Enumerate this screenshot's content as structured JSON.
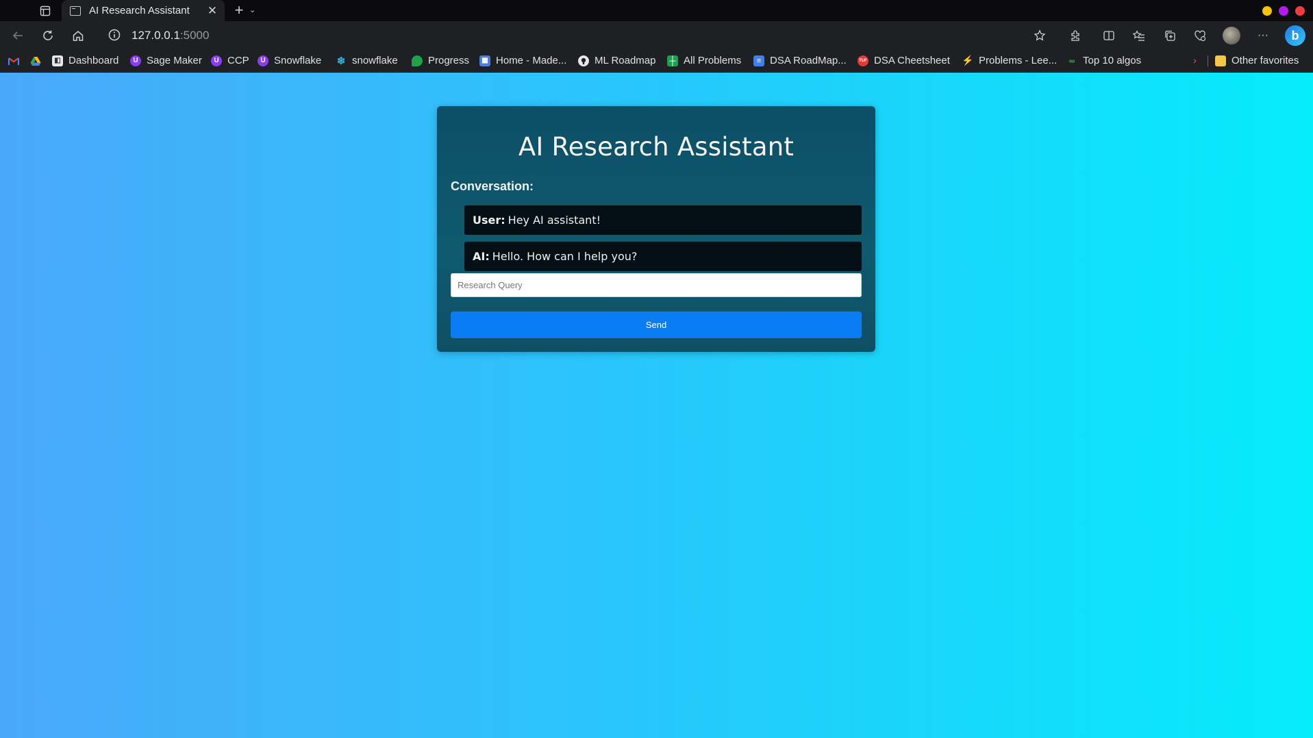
{
  "browser": {
    "tab": {
      "title": "AI Research Assistant",
      "close_glyph": "✕"
    },
    "new_tab_glyph": "+",
    "tab_menu_glyph": "⌄",
    "window_controls": [
      "#f5c400",
      "#b21cf0",
      "#f23b3b"
    ],
    "url": {
      "host": "127.0.0.1",
      "port": ":5000"
    }
  },
  "bookmarks": {
    "items": [
      {
        "label": "",
        "icon": "gmail-icon",
        "color": "#ea4335"
      },
      {
        "label": "",
        "icon": "google-drive-icon",
        "color": "#34a853"
      },
      {
        "label": "Dashboard",
        "icon": "dashboard-icon",
        "color": "#e8e8e8"
      },
      {
        "label": "Sage Maker",
        "icon": "sagemaker-icon",
        "color": "#8b3cf5"
      },
      {
        "label": "CCP",
        "icon": "ccp-icon",
        "color": "#8b3cf5"
      },
      {
        "label": "Snowflake",
        "icon": "snowflake-course-icon",
        "color": "#8b3cf5"
      },
      {
        "label": "snowflake",
        "icon": "snowflake-icon",
        "color": "#29b5e8"
      },
      {
        "label": "Progress",
        "icon": "evernote-icon",
        "color": "#1fa34a"
      },
      {
        "label": "Home - Made...",
        "icon": "home-icon",
        "color": "#4d7fd9"
      },
      {
        "label": "ML Roadmap",
        "icon": "github-icon",
        "color": "#e8e8e8"
      },
      {
        "label": "All Problems",
        "icon": "sheets-icon",
        "color": "#1e9e4f"
      },
      {
        "label": "DSA RoadMap...",
        "icon": "docs-icon",
        "color": "#3f7ff2"
      },
      {
        "label": "DSA Cheetsheet",
        "icon": "tuf-icon",
        "color": "#e53935"
      },
      {
        "label": "Problems - Lee...",
        "icon": "leetcode-icon",
        "color": "#f5a623"
      },
      {
        "label": "Top 10 algos",
        "icon": "link-icon",
        "color": "#3ab05a"
      }
    ],
    "other_favorites": "Other favorites"
  },
  "app": {
    "title": "AI Research Assistant",
    "conversation_label": "Conversation:",
    "messages": [
      {
        "speaker": "User:",
        "text": "Hey AI assistant!"
      },
      {
        "speaker": "AI:",
        "text": "Hello. How can I help you?"
      }
    ],
    "query_placeholder": "Research Query",
    "send_label": "Send"
  }
}
